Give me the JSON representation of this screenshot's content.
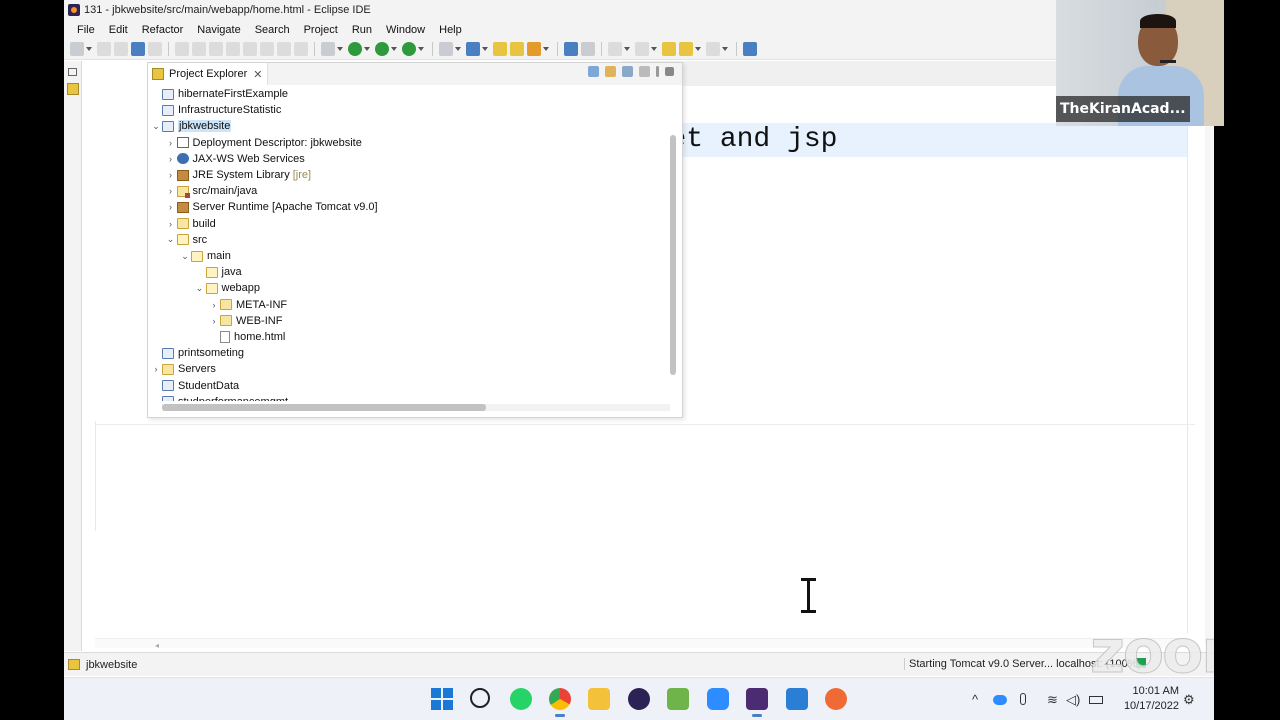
{
  "window": {
    "title": "131 - jbkwebsite/src/main/webapp/home.html - Eclipse IDE"
  },
  "menubar": {
    "items": [
      "File",
      "Edit",
      "Refactor",
      "Navigate",
      "Search",
      "Project",
      "Run",
      "Window",
      "Help"
    ]
  },
  "explorer": {
    "tab_label": "Project Explorer",
    "tab_close": "✕",
    "tree": [
      {
        "label": "hibernateFirstExample",
        "icon": "project-icon",
        "depth": 0,
        "chevron": ""
      },
      {
        "label": "InfrastructureStatistic",
        "icon": "project-icon",
        "depth": 0,
        "chevron": ""
      },
      {
        "label": "jbkwebsite",
        "icon": "project-icon",
        "depth": 0,
        "chevron": "⌄",
        "selected": true
      },
      {
        "label": "Deployment Descriptor: jbkwebsite",
        "icon": "deployment-descriptor-icon",
        "depth": 1,
        "chevron": "›"
      },
      {
        "label": "JAX-WS Web Services",
        "icon": "web-services-icon",
        "depth": 1,
        "chevron": "›"
      },
      {
        "label": "JRE System Library",
        "decoration": "[jre]",
        "icon": "library-icon",
        "depth": 1,
        "chevron": "›"
      },
      {
        "label": "src/main/java",
        "icon": "source-folder-icon",
        "depth": 1,
        "chevron": "›"
      },
      {
        "label": "Server Runtime [Apache Tomcat v9.0]",
        "icon": "library-icon",
        "depth": 1,
        "chevron": "›"
      },
      {
        "label": "build",
        "icon": "folder-icon",
        "depth": 1,
        "chevron": "›"
      },
      {
        "label": "src",
        "icon": "folder-open-icon",
        "depth": 1,
        "chevron": "⌄"
      },
      {
        "label": "main",
        "icon": "folder-open-icon",
        "depth": 2,
        "chevron": "⌄"
      },
      {
        "label": "java",
        "icon": "folder-open-icon",
        "depth": 3,
        "chevron": ""
      },
      {
        "label": "webapp",
        "icon": "folder-open-icon",
        "depth": 3,
        "chevron": "⌄"
      },
      {
        "label": "META-INF",
        "icon": "folder-icon",
        "depth": 4,
        "chevron": "›"
      },
      {
        "label": "WEB-INF",
        "icon": "folder-icon",
        "depth": 4,
        "chevron": "›"
      },
      {
        "label": "home.html",
        "icon": "file-icon",
        "depth": 4,
        "chevron": ""
      },
      {
        "label": "printsometing",
        "icon": "project-icon",
        "depth": 0,
        "chevron": ""
      },
      {
        "label": "Servers",
        "icon": "folder-icon",
        "depth": 0,
        "chevron": "›"
      },
      {
        "label": "StudentData",
        "icon": "project-icon",
        "depth": 0,
        "chevron": ""
      },
      {
        "label": "studperformancemgmt",
        "icon": "project-icon",
        "depth": 0,
        "chevron": ""
      }
    ]
  },
  "editor": {
    "visible_text": "rvlet and jsp"
  },
  "statusbar": {
    "selected_project": "jbkwebsite",
    "progress_text": "Starting Tomcat v9.0 Server... localhost: (100%)"
  },
  "taskbar": {
    "time": "10:01 AM",
    "date": "10/17/2022"
  },
  "webcam": {
    "name": "TheKiranAcad..."
  },
  "watermark": "zoom",
  "colors": {
    "selection": "#cce4f7",
    "line_highlight": "#e8f2fe",
    "accent": "#1a78d6"
  }
}
